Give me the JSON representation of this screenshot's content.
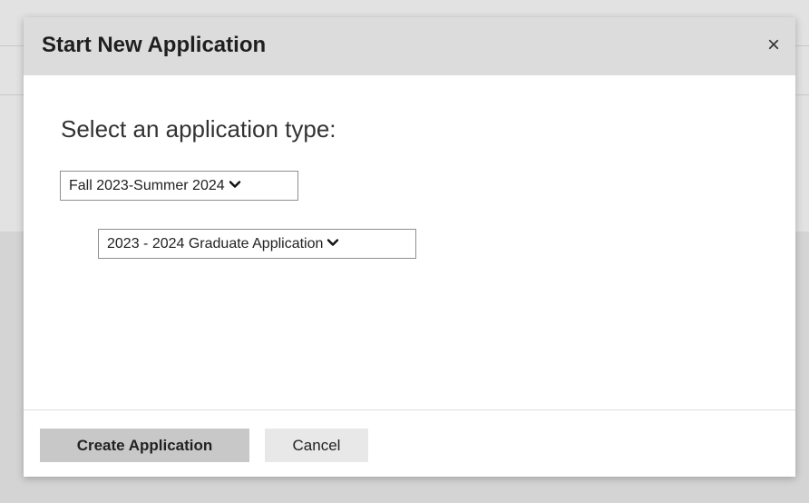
{
  "modal": {
    "title": "Start New Application",
    "close_label": "×",
    "prompt": "Select an application type:",
    "term_select": {
      "selected": "Fall 2023-Summer 2024"
    },
    "application_select": {
      "selected": "2023 - 2024 Graduate Application"
    },
    "create_label": "Create Application",
    "cancel_label": "Cancel"
  },
  "icons": {
    "close": "close-icon",
    "dropdown": "chevron-down-icon"
  },
  "colors": {
    "header_bg": "#dcdcdc",
    "primary_button_bg": "#c8c8c8",
    "secondary_button_bg": "#e8e8e8",
    "overlay_bg": "#d4d4d4"
  }
}
